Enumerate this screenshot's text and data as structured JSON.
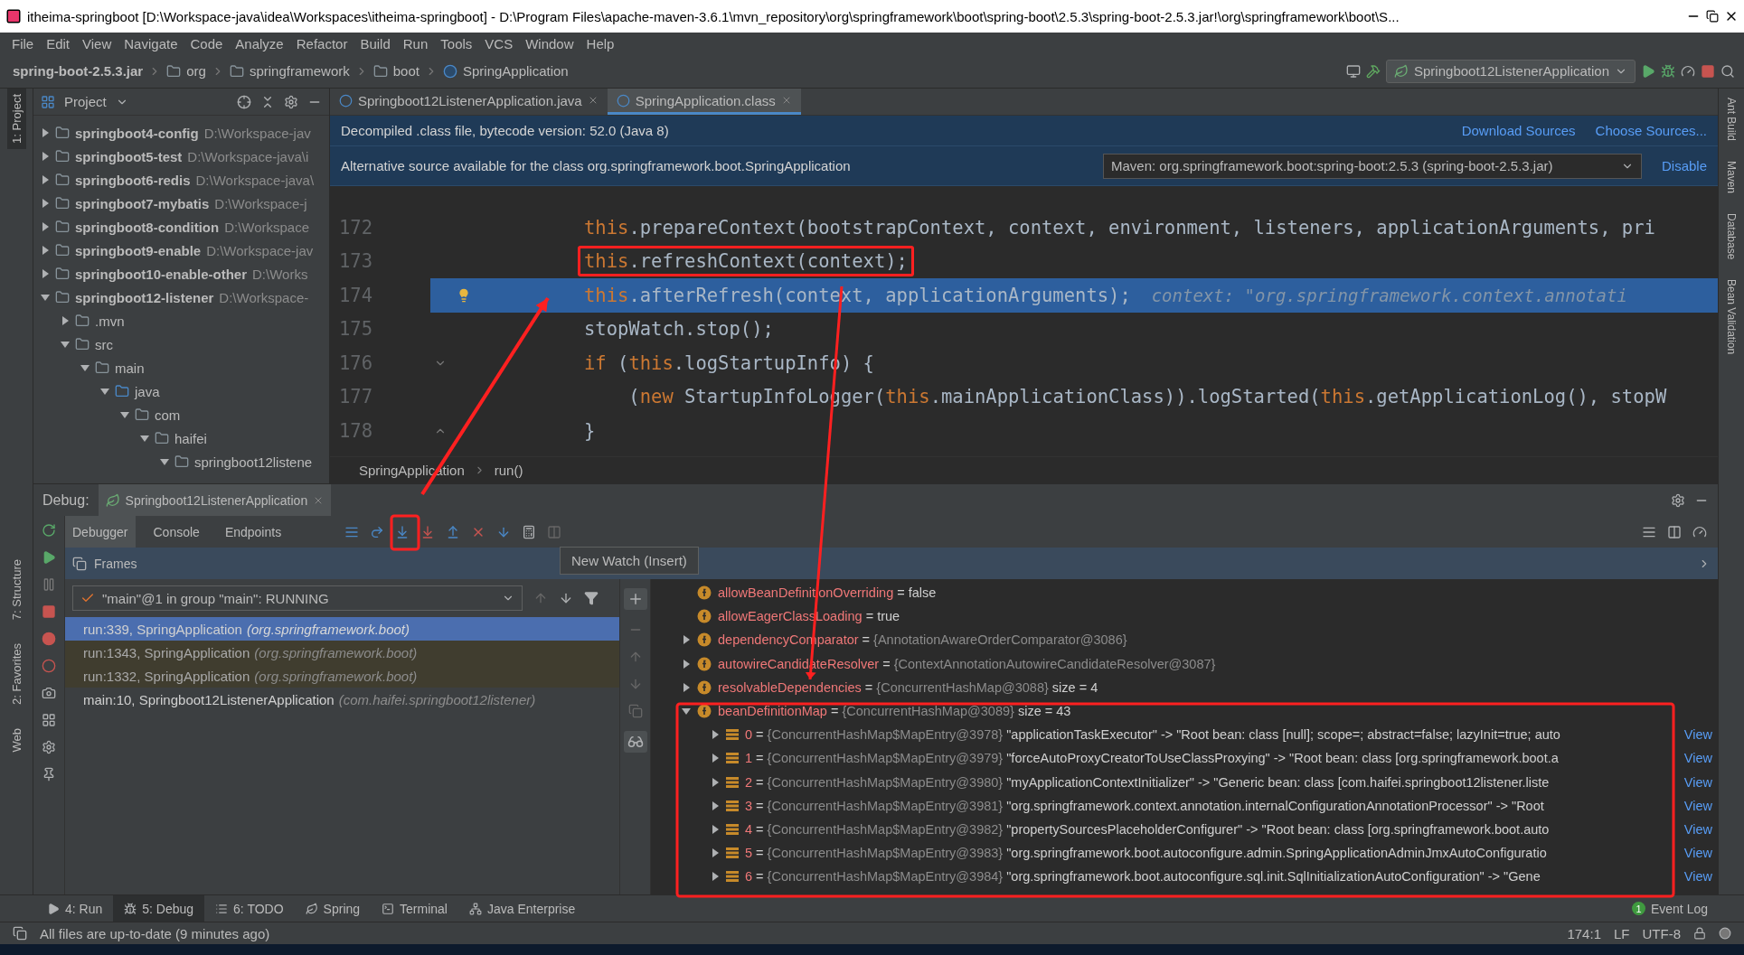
{
  "window": {
    "title": "itheima-springboot [D:\\Workspace-java\\idea\\Workspaces\\itheima-springboot] - D:\\Program Files\\apache-maven-3.6.1\\mvn_repository\\org\\springframework\\boot\\spring-boot\\2.5.3\\spring-boot-2.5.3.jar!\\org\\springframework\\boot\\S..."
  },
  "menu": [
    "File",
    "Edit",
    "View",
    "Navigate",
    "Code",
    "Analyze",
    "Refactor",
    "Build",
    "Run",
    "Tools",
    "VCS",
    "Window",
    "Help"
  ],
  "breadcrumbs": [
    {
      "label": "spring-boot-2.5.3.jar",
      "kind": "jar"
    },
    {
      "label": "org",
      "kind": "package"
    },
    {
      "label": "springframework",
      "kind": "package"
    },
    {
      "label": "boot",
      "kind": "package"
    },
    {
      "label": "SpringApplication",
      "kind": "class"
    }
  ],
  "run_config": "Springboot12ListenerApplication",
  "left_tools": [
    {
      "label": "1: Project",
      "selected": true
    },
    {
      "label": "7: Structure",
      "selected": false
    },
    {
      "label": "2: Favorites",
      "selected": false
    },
    {
      "label": "Web",
      "selected": false
    }
  ],
  "right_tools": [
    "Ant Build",
    "Maven",
    "Database",
    "Bean Validation"
  ],
  "project": {
    "title": "Project",
    "items": [
      {
        "name": "springboot4-config",
        "path": "D:\\Workspace-jav",
        "kind": "module",
        "expanded": false
      },
      {
        "name": "springboot5-test",
        "path": "D:\\Workspace-java\\i",
        "kind": "module",
        "expanded": false
      },
      {
        "name": "springboot6-redis",
        "path": "D:\\Workspace-java\\",
        "kind": "module",
        "expanded": false
      },
      {
        "name": "springboot7-mybatis",
        "path": "D:\\Workspace-j",
        "kind": "module",
        "expanded": false
      },
      {
        "name": "springboot8-condition",
        "path": "D:\\Workspace",
        "kind": "module",
        "expanded": false
      },
      {
        "name": "springboot9-enable",
        "path": "D:\\Workspace-jav",
        "kind": "module",
        "expanded": false
      },
      {
        "name": "springboot10-enable-other",
        "path": "D:\\Works",
        "kind": "module",
        "expanded": false
      },
      {
        "name": "springboot12-listener",
        "path": "D:\\Workspace-",
        "kind": "module",
        "expanded": true,
        "children": [
          {
            "name": ".mvn",
            "kind": "folder",
            "expanded": false
          },
          {
            "name": "src",
            "kind": "folder",
            "expanded": true,
            "children": [
              {
                "name": "main",
                "kind": "folder",
                "expanded": true,
                "children": [
                  {
                    "name": "java",
                    "kind": "source",
                    "expanded": true,
                    "children": [
                      {
                        "name": "com",
                        "kind": "package",
                        "expanded": true,
                        "children": [
                          {
                            "name": "haifei",
                            "kind": "package",
                            "expanded": true,
                            "children": [
                              {
                                "name": "springboot12listene",
                                "kind": "package",
                                "expanded": true
                              }
                            ]
                          }
                        ]
                      }
                    ]
                  }
                ]
              }
            ]
          }
        ]
      }
    ]
  },
  "editor": {
    "tabs": [
      {
        "label": "Springboot12ListenerApplication.java",
        "selected": false
      },
      {
        "label": "SpringApplication.class",
        "selected": true
      }
    ],
    "notice": "Decompiled .class file, bytecode version: 52.0 (Java 8)",
    "notice_links": [
      "Download Sources",
      "Choose Sources..."
    ],
    "alt_notice": "Alternative source available for the class org.springframework.boot.SpringApplication",
    "alt_source": "Maven: org.springframework.boot:spring-boot:2.5.3 (spring-boot-2.5.3.jar)",
    "alt_action": "Disable",
    "lines": [
      {
        "number": "172",
        "current": false,
        "annotated": false,
        "tokens": [
          {
            "text": "this",
            "kind": "keyword"
          },
          {
            "text": ".prepareContext(bootstrapContext, context, environment, listeners, applicationArguments, pri",
            "kind": "plain"
          }
        ]
      },
      {
        "number": "173",
        "current": false,
        "annotated": true,
        "tokens": [
          {
            "text": "this",
            "kind": "keyword"
          },
          {
            "text": ".refreshContext(context);",
            "kind": "plain"
          }
        ]
      },
      {
        "number": "174",
        "current": true,
        "annotated": false,
        "bulb": true,
        "tokens": [
          {
            "text": "this",
            "kind": "keyword"
          },
          {
            "text": ".afterRefresh(context, applicationArguments);",
            "kind": "plain"
          },
          {
            "text": "  context: \"org.springframework.context.annotati",
            "kind": "hint"
          }
        ]
      },
      {
        "number": "175",
        "current": false,
        "annotated": false,
        "tokens": [
          {
            "text": "stopWatch.stop();",
            "kind": "plain"
          }
        ]
      },
      {
        "number": "176",
        "current": false,
        "annotated": false,
        "fold_start": true,
        "tokens": [
          {
            "text": "if",
            "kind": "keyword"
          },
          {
            "text": " (",
            "kind": "plain"
          },
          {
            "text": "this",
            "kind": "keyword"
          },
          {
            "text": ".logStartupInfo) {",
            "kind": "plain"
          }
        ]
      },
      {
        "number": "177",
        "current": false,
        "annotated": false,
        "tokens": [
          {
            "text": "    (",
            "kind": "plain"
          },
          {
            "text": "new",
            "kind": "keyword"
          },
          {
            "text": " StartupInfoLogger(",
            "kind": "plain"
          },
          {
            "text": "this",
            "kind": "keyword"
          },
          {
            "text": ".mainApplicationClass)).logStarted(",
            "kind": "plain"
          },
          {
            "text": "this",
            "kind": "keyword"
          },
          {
            "text": ".getApplicationLog(), stopW",
            "kind": "plain"
          }
        ]
      },
      {
        "number": "178",
        "current": false,
        "annotated": false,
        "fold_end": true,
        "tokens": [
          {
            "text": "}",
            "kind": "plain"
          }
        ]
      }
    ],
    "crumbs": [
      "SpringApplication",
      "run()"
    ]
  },
  "debug": {
    "label": "Debug:",
    "session": "Springboot12ListenerApplication",
    "tabs": [
      {
        "label": "Debugger",
        "selected": true
      },
      {
        "label": "Console",
        "selected": false
      },
      {
        "label": "Endpoints",
        "selected": false
      }
    ],
    "frames_title": "Frames",
    "thread": "\"main\"@1 in group \"main\": RUNNING",
    "tooltip": "New Watch (Insert)",
    "frames": [
      {
        "method": "run:339, SpringApplication",
        "package": "(org.springframework.boot)",
        "selected": true,
        "library": false
      },
      {
        "method": "run:1343, SpringApplication",
        "package": "(org.springframework.boot)",
        "selected": false,
        "library": true
      },
      {
        "method": "run:1332, SpringApplication",
        "package": "(org.springframework.boot)",
        "selected": false,
        "library": true
      },
      {
        "method": "main:10, Springboot12ListenerApplication",
        "package": "(com.haifei.springboot12listener)",
        "selected": false,
        "library": false
      }
    ],
    "variables": [
      {
        "name": "allowBeanDefinitionOverriding",
        "sep": "=",
        "value": "false",
        "kind": "primitive"
      },
      {
        "name": "allowEagerClassLoading",
        "sep": "=",
        "value": "true",
        "kind": "primitive"
      },
      {
        "name": "dependencyComparator",
        "sep": "=",
        "value": "{AnnotationAwareOrderComparator@3086}",
        "kind": "object",
        "expanded": false
      },
      {
        "name": "autowireCandidateResolver",
        "sep": "=",
        "value": "{ContextAnnotationAutowireCandidateResolver@3087}",
        "kind": "object",
        "expanded": false
      },
      {
        "name": "resolvableDependencies",
        "sep": "=",
        "value": "{ConcurrentHashMap@3088}",
        "size": "size = 4",
        "kind": "object",
        "expanded": false
      },
      {
        "name": "beanDefinitionMap",
        "sep": "=",
        "value": "{ConcurrentHashMap@3089}",
        "size": "size = 43",
        "kind": "object",
        "expanded": true,
        "entries": [
          {
            "index": "0",
            "sep": "=",
            "ref": "{ConcurrentHashMap$MapEntry@3978}",
            "text": "\"applicationTaskExecutor\" -> \"Root bean: class [null]; scope=; abstract=false; lazyInit=true; auto",
            "link": "View"
          },
          {
            "index": "1",
            "sep": "=",
            "ref": "{ConcurrentHashMap$MapEntry@3979}",
            "text": "\"forceAutoProxyCreatorToUseClassProxying\" -> \"Root bean: class [org.springframework.boot.a",
            "link": "View"
          },
          {
            "index": "2",
            "sep": "=",
            "ref": "{ConcurrentHashMap$MapEntry@3980}",
            "text": "\"myApplicationContextInitializer\" -> \"Generic bean: class [com.haifei.springboot12listener.liste",
            "link": "View"
          },
          {
            "index": "3",
            "sep": "=",
            "ref": "{ConcurrentHashMap$MapEntry@3981}",
            "text": "\"org.springframework.context.annotation.internalConfigurationAnnotationProcessor\" -> \"Root",
            "link": "View"
          },
          {
            "index": "4",
            "sep": "=",
            "ref": "{ConcurrentHashMap$MapEntry@3982}",
            "text": "\"propertySourcesPlaceholderConfigurer\" -> \"Root bean: class [org.springframework.boot.auto",
            "link": "View"
          },
          {
            "index": "5",
            "sep": "=",
            "ref": "{ConcurrentHashMap$MapEntry@3983}",
            "text": "\"org.springframework.boot.autoconfigure.admin.SpringApplicationAdminJmxAutoConfiguratio",
            "link": "View"
          },
          {
            "index": "6",
            "sep": "=",
            "ref": "{ConcurrentHashMap$MapEntry@3984}",
            "text": "\"org.springframework.boot.autoconfigure.sql.init.SqlInitializationAutoConfiguration\" -> \"Gene",
            "link": "View"
          }
        ]
      }
    ]
  },
  "bottom_tabs": [
    {
      "label": "4: Run",
      "kind": "run",
      "selected": false
    },
    {
      "label": "5: Debug",
      "kind": "debug",
      "selected": true
    },
    {
      "label": "6: TODO",
      "kind": "todo",
      "selected": false
    },
    {
      "label": "Spring",
      "kind": "spring",
      "selected": false
    },
    {
      "label": "Terminal",
      "kind": "terminal",
      "selected": false
    },
    {
      "label": "Java Enterprise",
      "kind": "enterprise",
      "selected": false
    }
  ],
  "event_log": {
    "label": "Event Log",
    "count": "1"
  },
  "status": {
    "message": "All files are up-to-date (9 minutes ago)",
    "position": "174:1",
    "line_ending": "LF",
    "encoding": "UTF-8"
  }
}
